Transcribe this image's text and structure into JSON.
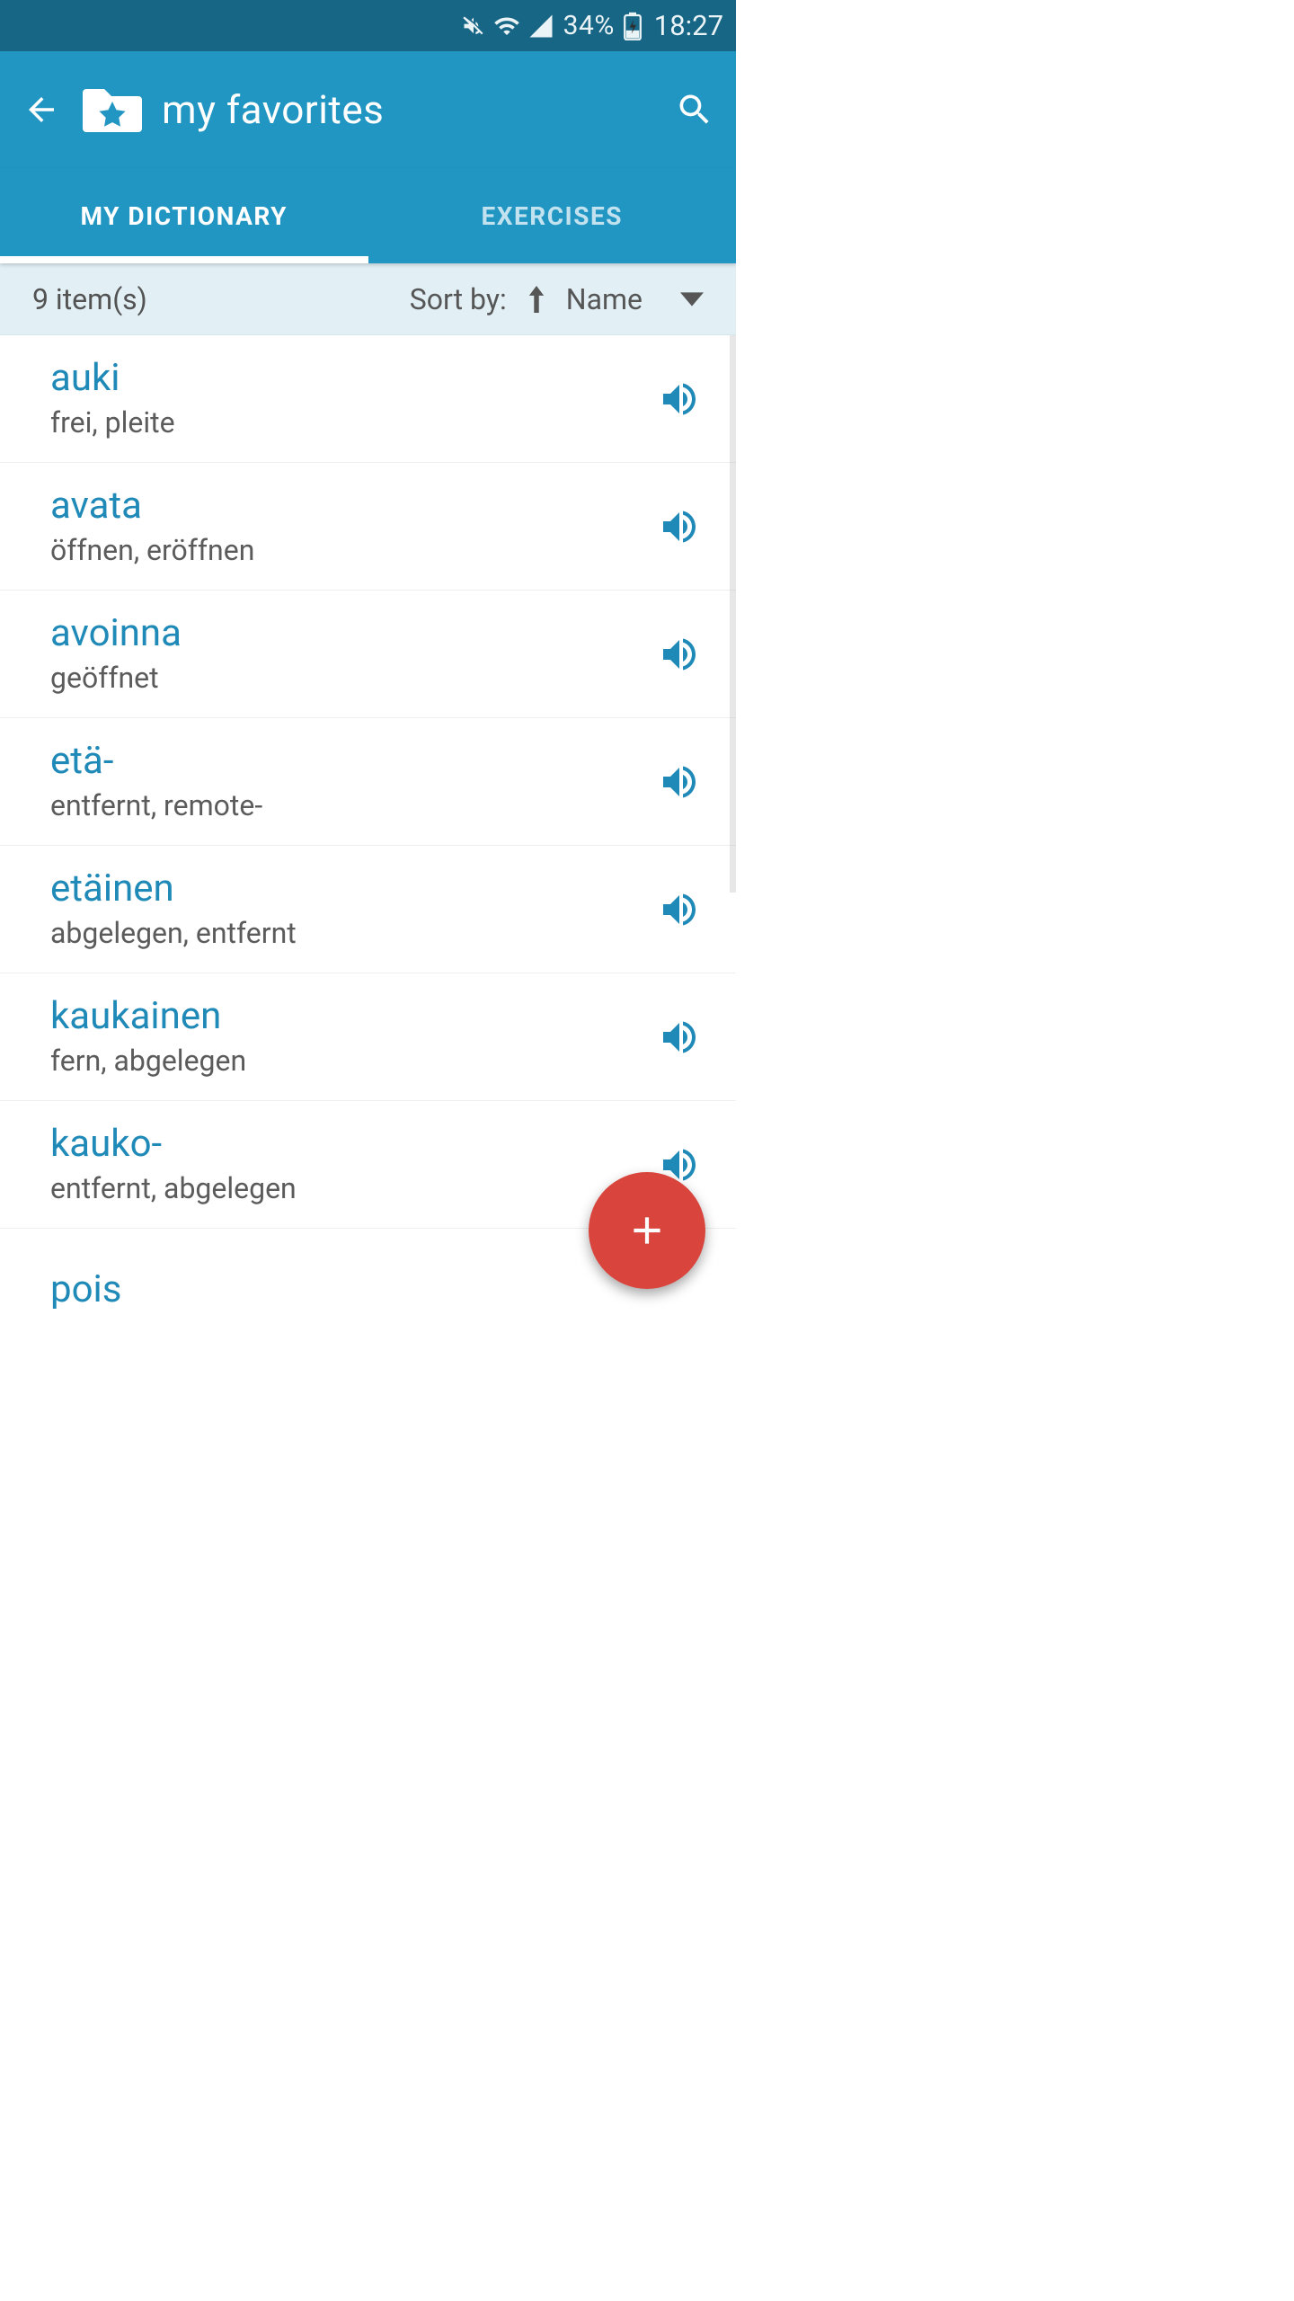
{
  "status": {
    "battery_pct": "34%",
    "time": "18:27"
  },
  "appbar": {
    "title": "my favorites"
  },
  "tabs": {
    "dictionary": "MY DICTIONARY",
    "exercises": "EXERCISES"
  },
  "sortbar": {
    "count": "9 item(s)",
    "label": "Sort by:",
    "field": "Name"
  },
  "items": [
    {
      "word": "auki",
      "trans": "frei, pleite"
    },
    {
      "word": "avata",
      "trans": "öffnen, eröffnen"
    },
    {
      "word": "avoinna",
      "trans": "geöffnet"
    },
    {
      "word": "etä-",
      "trans": "entfernt, remote-"
    },
    {
      "word": "etäinen",
      "trans": "abgelegen, entfernt"
    },
    {
      "word": "kaukainen",
      "trans": "fern, abgelegen"
    },
    {
      "word": "kauko-",
      "trans": "entfernt, abgelegen"
    },
    {
      "word": "pois",
      "trans": ""
    }
  ]
}
